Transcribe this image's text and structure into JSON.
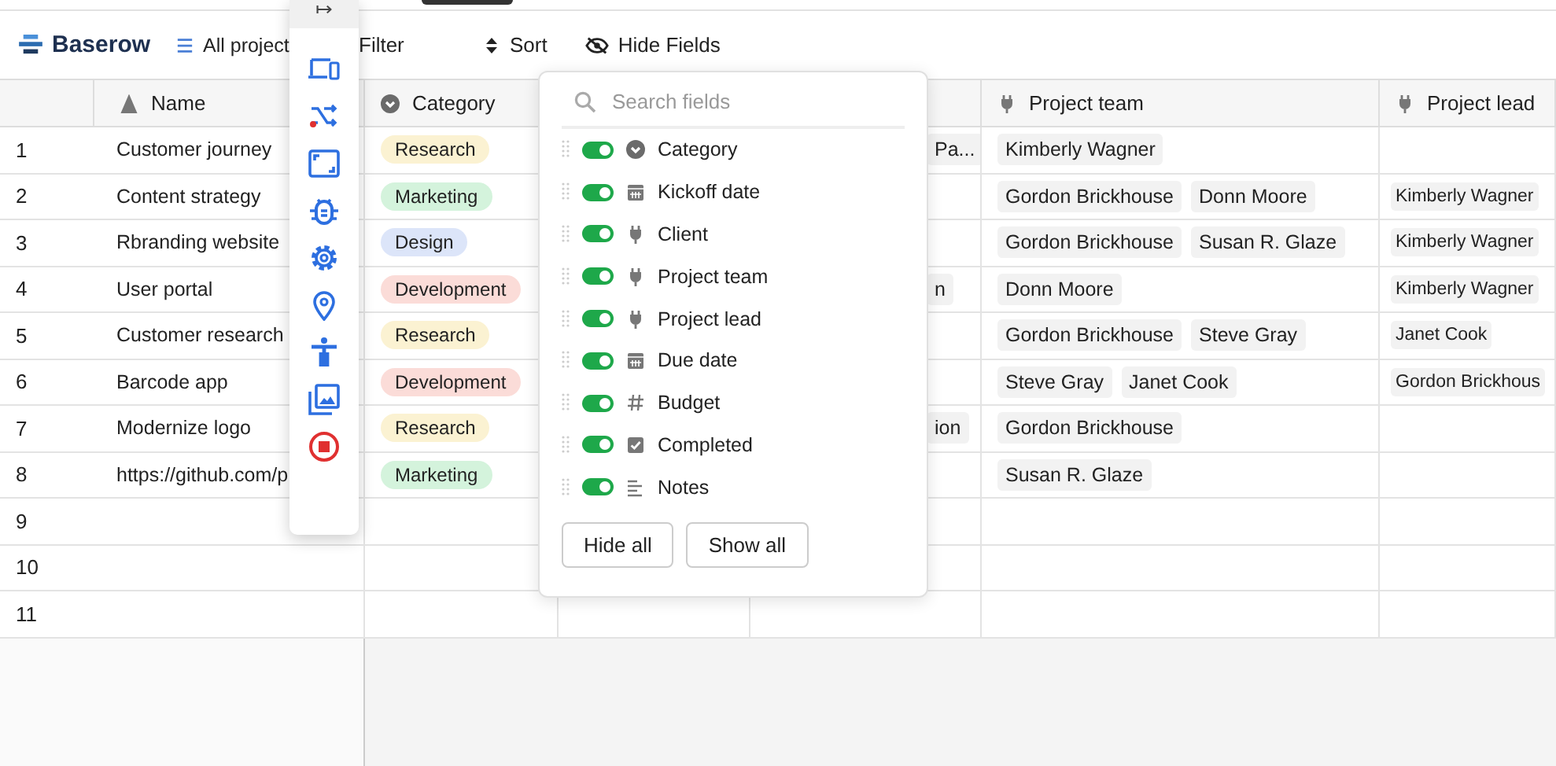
{
  "toolbar": {
    "brand": "Baserow",
    "view": "All project",
    "filter": "Filter",
    "sort": "Sort",
    "hide_fields": "Hide Fields"
  },
  "floating_toolbar": {
    "glyph": "↦"
  },
  "columns": [
    {
      "name": "Name",
      "kind": "text"
    },
    {
      "name": "Category",
      "kind": "select"
    },
    {
      "name": "Project team",
      "kind": "link"
    },
    {
      "name": "Project lead",
      "kind": "link"
    }
  ],
  "rows": [
    {
      "number": "1",
      "name": "Customer journey",
      "category": {
        "label": "Research",
        "color": "#fbf2d2"
      },
      "column_4": "Pa...",
      "project_team": [
        "Kimberly Wagner"
      ],
      "project_lead": []
    },
    {
      "number": "2",
      "name": "Content strategy",
      "category": {
        "label": "Marketing",
        "color": "#d4f3dc"
      },
      "project_team": [
        "Gordon Brickhouse",
        "Donn Moore"
      ],
      "project_lead": [
        "Kimberly Wagner"
      ]
    },
    {
      "number": "3",
      "name": "Rbranding website",
      "category": {
        "label": "Design",
        "color": "#dce5f9"
      },
      "project_team": [
        "Gordon Brickhouse",
        "Susan R. Glaze"
      ],
      "project_lead": [
        "Kimberly Wagner"
      ]
    },
    {
      "number": "4",
      "name": "User portal",
      "category": {
        "label": "Development",
        "color": "#fbdcd8"
      },
      "column_4": "n",
      "project_team": [
        "Donn Moore"
      ],
      "project_lead": [
        "Kimberly Wagner"
      ]
    },
    {
      "number": "5",
      "name": "Customer research",
      "category": {
        "label": "Research",
        "color": "#fbf2d2"
      },
      "project_team": [
        "Gordon Brickhouse",
        "Steve Gray"
      ],
      "project_lead": [
        "Janet Cook"
      ]
    },
    {
      "number": "6",
      "name": "Barcode app",
      "category": {
        "label": "Development",
        "color": "#fbdcd8"
      },
      "project_team": [
        "Steve Gray",
        "Janet Cook"
      ],
      "project_lead": [
        "Gordon Brickhous"
      ]
    },
    {
      "number": "7",
      "name": "Modernize logo",
      "category": {
        "label": "Research",
        "color": "#fbf2d2"
      },
      "column_4": "ion",
      "project_team": [
        "Gordon Brickhouse"
      ],
      "project_lead": []
    },
    {
      "number": "8",
      "name": "https://github.com/p",
      "category": {
        "label": "Marketing",
        "color": "#d4f3dc"
      },
      "project_team": [
        "Susan R. Glaze"
      ],
      "project_lead": []
    },
    {
      "number": "9"
    },
    {
      "number": "10"
    },
    {
      "number": "11"
    }
  ],
  "hide_fields_popup": {
    "search_placeholder": "Search fields",
    "fields": [
      {
        "label": "Category",
        "kind": "select",
        "on": true
      },
      {
        "label": "Kickoff date",
        "kind": "date",
        "on": true
      },
      {
        "label": "Client",
        "kind": "link",
        "on": true
      },
      {
        "label": "Project team",
        "kind": "link",
        "on": true
      },
      {
        "label": "Project lead",
        "kind": "link",
        "on": true
      },
      {
        "label": "Due date",
        "kind": "date",
        "on": true
      },
      {
        "label": "Budget",
        "kind": "number",
        "on": true
      },
      {
        "label": "Completed",
        "kind": "boolean",
        "on": true
      },
      {
        "label": "Notes",
        "kind": "notes",
        "on": true
      }
    ],
    "buttons": [
      "Hide all",
      "Show all"
    ]
  }
}
